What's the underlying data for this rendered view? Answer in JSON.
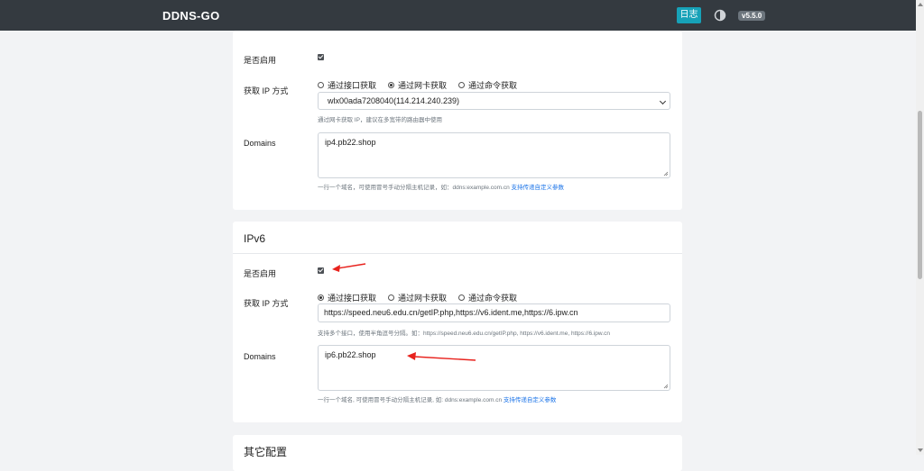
{
  "navbar": {
    "brand": "DDNS-GO",
    "log_button": "日志",
    "theme_icon": "theme-toggle-icon",
    "version": "v5.5.0"
  },
  "ipv4": {
    "enabled_label": "是否启用",
    "enabled": true,
    "method_label": "获取 IP 方式",
    "methods": [
      {
        "label": "通过接口获取",
        "selected": false
      },
      {
        "label": "通过网卡获取",
        "selected": true
      },
      {
        "label": "通过命令获取",
        "selected": false
      }
    ],
    "interface_select": "wlx00ada7208040(114.214.240.239)",
    "interface_help": "通过网卡获取 IP，建议在多宽带的路由器中使用",
    "domains_label": "Domains",
    "domains_value": "ip4.pb22.shop",
    "domains_help": "一行一个域名，可使用冒号手动分隔主机记录，如：ddns:example.com.cn",
    "domains_help_link": "支持传递自定义参数"
  },
  "ipv6": {
    "title": "IPv6",
    "enabled_label": "是否启用",
    "enabled": true,
    "method_label": "获取 IP 方式",
    "methods": [
      {
        "label": "通过接口获取",
        "selected": true
      },
      {
        "label": "通过网卡获取",
        "selected": false
      },
      {
        "label": "通过命令获取",
        "selected": false
      }
    ],
    "url_value": "https://speed.neu6.edu.cn/getIP.php,https://v6.ident.me,https://6.ipw.cn",
    "url_help": "支持多个接口，使用半角逗号分隔。如：https://speed.neu6.edu.cn/getIP.php, https://v6.ident.me, https://6.ipw.cn",
    "domains_label": "Domains",
    "domains_value": "ip6.pb22.shop",
    "domains_help": "一行一个域名, 可使用冒号手动分隔主机记录, 如: ddns:example.com.cn",
    "domains_help_link": "支持传递自定义参数"
  },
  "other": {
    "title": "其它配置"
  },
  "annotation_color": "#e8231e"
}
